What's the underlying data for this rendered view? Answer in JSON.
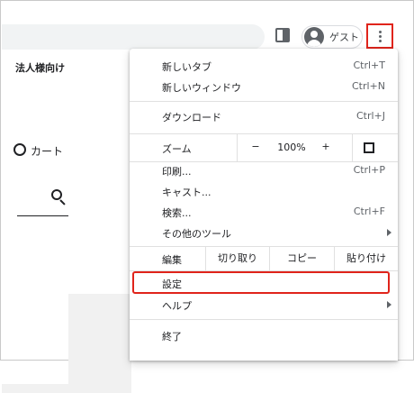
{
  "toolbar": {
    "profile_label": "ゲスト"
  },
  "page": {
    "corporate_label": "法人様向け",
    "cart_label": "カート"
  },
  "menu": {
    "new_tab": {
      "label": "新しいタブ",
      "shortcut": "Ctrl+T"
    },
    "new_window": {
      "label": "新しいウィンドウ",
      "shortcut": "Ctrl+N"
    },
    "downloads": {
      "label": "ダウンロード",
      "shortcut": "Ctrl+J"
    },
    "zoom": {
      "label": "ズーム",
      "minus": "−",
      "value": "100%",
      "plus": "+"
    },
    "print": {
      "label": "印刷...",
      "shortcut": "Ctrl+P"
    },
    "cast": {
      "label": "キャスト..."
    },
    "find": {
      "label": "検索...",
      "shortcut": "Ctrl+F"
    },
    "more_tools": {
      "label": "その他のツール"
    },
    "edit": {
      "label": "編集",
      "cut": "切り取り",
      "copy": "コピー",
      "paste": "貼り付け"
    },
    "settings": {
      "label": "設定"
    },
    "help": {
      "label": "ヘルプ"
    },
    "exit": {
      "label": "終了"
    }
  },
  "colors": {
    "highlight": "#e0241b"
  }
}
